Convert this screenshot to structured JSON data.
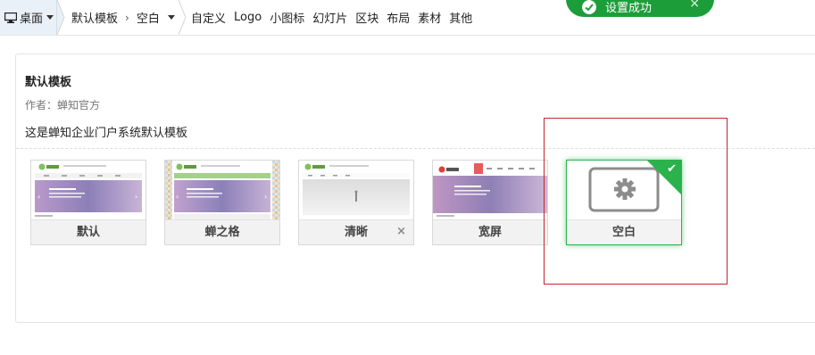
{
  "topbar": {
    "desktop_label": "桌面",
    "breadcrumb": {
      "item1": "默认模板",
      "separator": "›",
      "item2": "空白"
    },
    "nav": [
      "自定义",
      "Logo",
      "小图标",
      "幻灯片",
      "区块",
      "布局",
      "素材",
      "其他"
    ]
  },
  "toast": {
    "message": "设置成功",
    "close": "×"
  },
  "template": {
    "title": "默认模板",
    "author": "作者：蝉知官方",
    "description": "这是蝉知企业门户系统默认模板"
  },
  "themes": [
    {
      "name": "默认"
    },
    {
      "name": "蝉之格"
    },
    {
      "name": "清晰",
      "delete_icon": "×"
    },
    {
      "name": "宽屏"
    },
    {
      "name": "空白",
      "selected": true
    }
  ],
  "colors": {
    "accent_green": "#2bb24c",
    "toast_green": "#1d9d3a",
    "highlight_red": "#c0282d"
  }
}
